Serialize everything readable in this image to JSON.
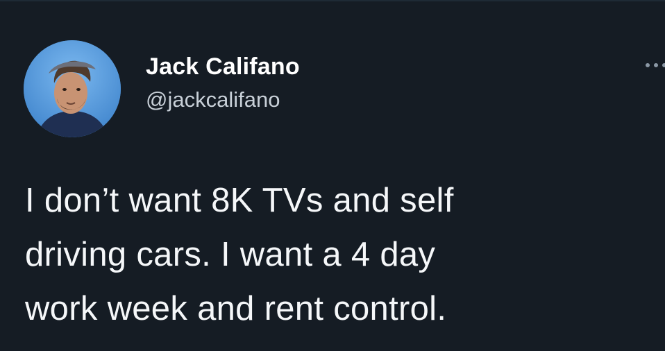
{
  "tweet": {
    "author": {
      "display_name": "Jack Califano",
      "handle": "@jackcalifano",
      "avatar_icon": "user-photo-avatar"
    },
    "more_icon": "more-horizontal-icon",
    "text_lines": [
      "I don’t want 8K TVs and self",
      "driving cars. I want a 4 day",
      "work week and rent control."
    ]
  },
  "colors": {
    "background": "#151c24",
    "text_primary": "#ffffff",
    "text_secondary": "#c8d0d8"
  }
}
